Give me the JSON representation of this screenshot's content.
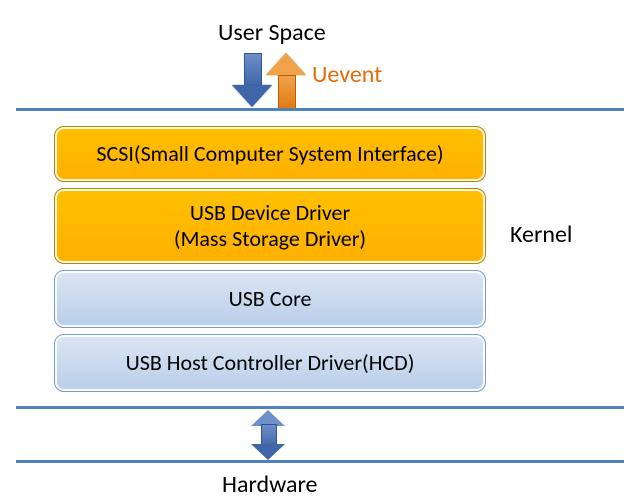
{
  "labels": {
    "user_space": "User Space",
    "uevent": "Uevent",
    "kernel": "Kernel",
    "hardware": "Hardware"
  },
  "layers": {
    "scsi": "SCSI(Small Computer System Interface)",
    "device_driver_line1": "USB Device Driver",
    "device_driver_line2": "(Mass Storage Driver)",
    "usb_core": "USB Core",
    "hcd": "USB Host Controller Driver(HCD)"
  },
  "chart_data": {
    "type": "diagram",
    "title": "USB mass storage stack in Linux kernel",
    "regions": [
      "User Space",
      "Kernel",
      "Hardware"
    ],
    "kernel_layers_top_to_bottom": [
      {
        "name": "SCSI (Small Computer System Interface)",
        "highlighted": true
      },
      {
        "name": "USB Device Driver (Mass Storage Driver)",
        "highlighted": true
      },
      {
        "name": "USB Core",
        "highlighted": false
      },
      {
        "name": "USB Host Controller Driver (HCD)",
        "highlighted": false
      }
    ],
    "arrows": [
      {
        "from": "User Space",
        "to": "Kernel",
        "direction": "down",
        "color": "blue"
      },
      {
        "from": "Kernel",
        "to": "User Space",
        "direction": "up",
        "color": "orange",
        "label": "Uevent"
      },
      {
        "from": "Kernel",
        "to": "Hardware",
        "direction": "both",
        "color": "blue"
      }
    ],
    "colors": {
      "highlight": "#ffc000",
      "normal": "#c7d8ef",
      "line": "#4f81bd",
      "uevent_text": "#e46c0a"
    }
  }
}
